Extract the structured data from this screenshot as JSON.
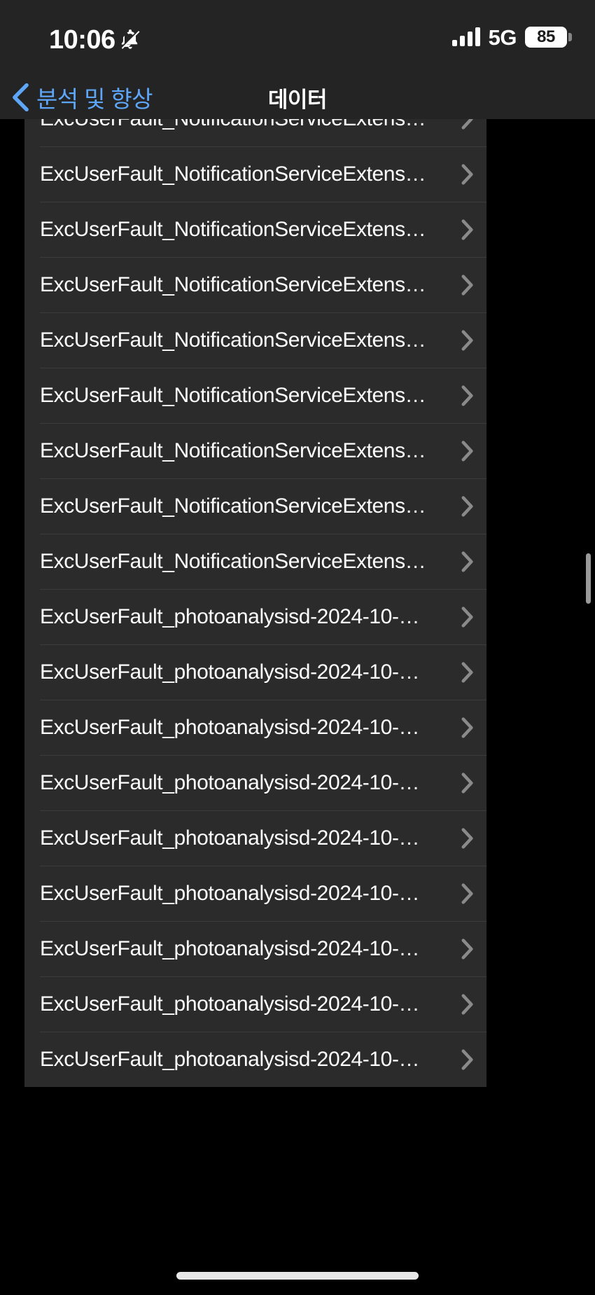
{
  "status_bar": {
    "time": "10:06",
    "bell_icon": "bell-slash-icon",
    "signal_icon": "cellular-signal-bars-icon",
    "signal_bars_filled": 4,
    "network_type": "5G",
    "battery_level": "85",
    "battery_icon": "battery-icon"
  },
  "nav_bar": {
    "back_icon": "chevron-left-icon",
    "back_label": "분석 및 향상",
    "title": "데이터"
  },
  "list": {
    "disclosure_icon": "chevron-right-icon",
    "rows": [
      {
        "label": "ExcUserFault_NotificationServiceExtens…"
      },
      {
        "label": "ExcUserFault_NotificationServiceExtens…"
      },
      {
        "label": "ExcUserFault_NotificationServiceExtens…"
      },
      {
        "label": "ExcUserFault_NotificationServiceExtens…"
      },
      {
        "label": "ExcUserFault_NotificationServiceExtens…"
      },
      {
        "label": "ExcUserFault_NotificationServiceExtens…"
      },
      {
        "label": "ExcUserFault_NotificationServiceExtens…"
      },
      {
        "label": "ExcUserFault_NotificationServiceExtens…"
      },
      {
        "label": "ExcUserFault_NotificationServiceExtens…"
      },
      {
        "label": "ExcUserFault_photoanalysisd-2024-10-…"
      },
      {
        "label": "ExcUserFault_photoanalysisd-2024-10-…"
      },
      {
        "label": "ExcUserFault_photoanalysisd-2024-10-…"
      },
      {
        "label": "ExcUserFault_photoanalysisd-2024-10-…"
      },
      {
        "label": "ExcUserFault_photoanalysisd-2024-10-…"
      },
      {
        "label": "ExcUserFault_photoanalysisd-2024-10-…"
      },
      {
        "label": "ExcUserFault_photoanalysisd-2024-10-…"
      },
      {
        "label": "ExcUserFault_photoanalysisd-2024-10-…"
      },
      {
        "label": "ExcUserFault_photoanalysisd-2024-10-…"
      }
    ]
  },
  "scroll_indicator": {
    "name": "vertical-scrollbar"
  },
  "home_indicator": {
    "name": "home-indicator"
  },
  "colors": {
    "accent_blue": "#5EA7F8",
    "cell_background": "#2b2b2b",
    "bar_background": "#242424",
    "separator": "#3c3c3c",
    "chevron_gray": "#8a8a8a",
    "page_background": "#000000"
  }
}
